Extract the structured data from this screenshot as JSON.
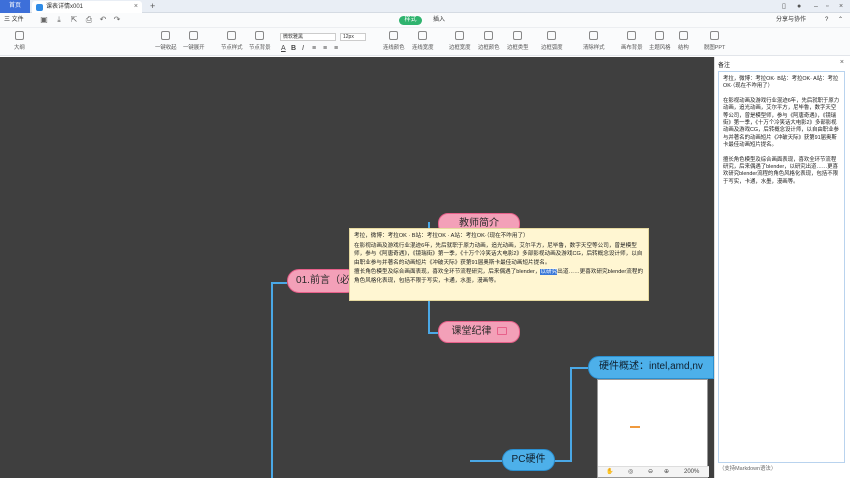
{
  "tabs": {
    "home": "首页",
    "doc": "课表详情x001"
  },
  "menu": {
    "file": "三 文件",
    "mode_active": "样式",
    "mode_insert": "插入",
    "share": "分享与协作",
    "help": "?"
  },
  "toolbar": {
    "outline": "大纲",
    "collapse_one": "一键收起",
    "expand_one": "一键展开",
    "node_style": "节点样式",
    "node_bg": "节点背景",
    "font": "微软雅黑",
    "font_size": "12px",
    "line_color": "连线颜色",
    "line_width": "连线宽度",
    "border_width": "边框宽度",
    "border_color": "边框颜色",
    "border_type": "边框类型",
    "border_radius": "边框弧度",
    "clear_style": "清除样式",
    "canvas_bg": "画布背景",
    "theme": "主题风格",
    "structure": "结构",
    "ppt": "脱图PPT"
  },
  "mindmap": {
    "top_node": "教师简介",
    "preface": "01.前言（必",
    "discipline": "课堂纪律",
    "pc_hw": "PC硬件",
    "hw_overview": "硬件概述：intel,amd,nv"
  },
  "tooltip": {
    "p1": "考拉，微博：考拉OK · B站：考拉OK · A站：考拉OK·（现在不咋用了）",
    "p2": "在影视动画及游戏行业混迹6年，先后就职于原力动画，追光动画，艾尔平方，尼毕鲁，数字天空等公司，曾是模型师，参与《阿唐奇遇》，《镜瑞街》第一季，《十万个冷笑话大电影2》多部影视动画及游戏CG，后转概念设计师，以自由职业参与并著名的动画短片《冲破天际》获第91届奥斯卡最佳动画短片提名。",
    "p3a": "擅长角色模型及综合画面表现，喜欢全环节流程研究，后来偶遇了blender，",
    "p3sel": "以研究",
    "p3b": "出道……更喜欢研究blender流程的角色风格化表现，包括不限于写实，卡通，水墨，漫画等。"
  },
  "thumb": {
    "zoom": "200%"
  },
  "side": {
    "title": "备注",
    "p1": "考拉，微博：考拉OK· B站：考拉OK· A站：考拉OK·（现在不咋用了）",
    "p2": "在影视动画及游戏行业混迹6年，先后就职于原力动画，追光动画，艾尔平方，尼毕鲁，数字天空等公司，曾是模型师，参与《阿唐奇遇》，《镜瑞街》第一季，《十万个冷笑话大电影2》多部影视动画及游戏CG，后转概念设计师，以自由职业参与并著名的动画短片《冲破天际》获第91届奥斯卡最佳动画短片提名。",
    "p3": "擅长角色模型及综合画面表现，喜欢全环节流程研究，后来偶遇了blender，以研究出道……更喜欢研究blender流程的角色风格化表现，包括不限于写实，卡通，水墨，漫画等。",
    "footer": "（支持Markdown语法）"
  }
}
